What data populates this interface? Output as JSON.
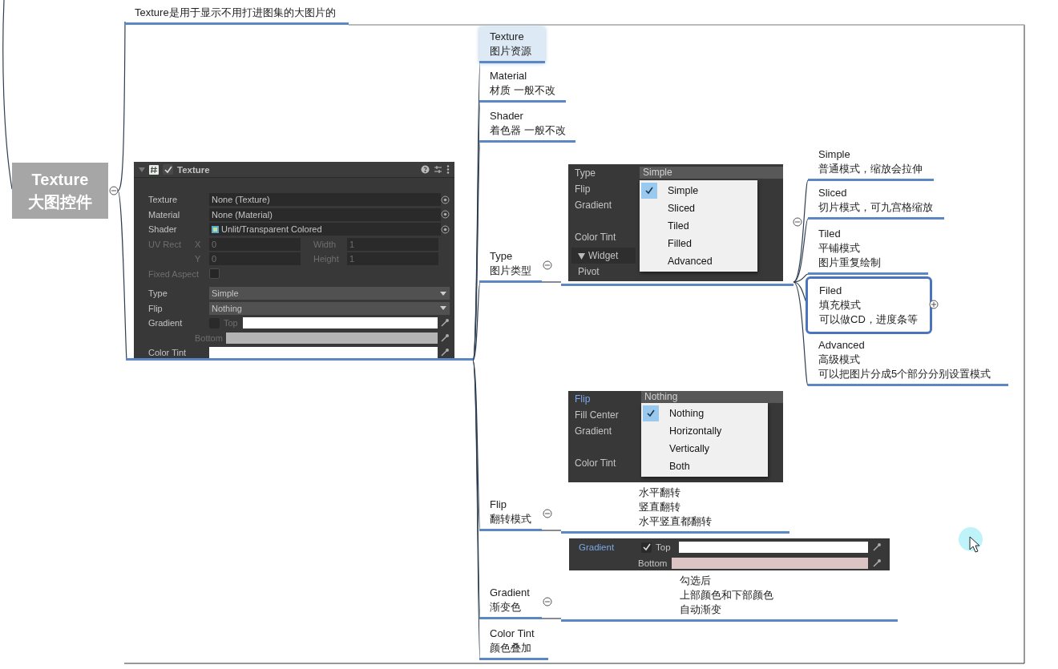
{
  "root": {
    "lines": [
      "Texture",
      "大图控件"
    ],
    "expanded": true
  },
  "root_note": {
    "lines": [
      "Texture是用于显示不用打进图集的大图片的"
    ]
  },
  "inspector": {
    "title": "Texture",
    "enabled": true,
    "fields": [
      {
        "kind": "object",
        "label": "Texture",
        "value": "None (Texture)",
        "disabled": false
      },
      {
        "kind": "shader",
        "label": "Material",
        "value": "None (Material)",
        "disabled": false
      },
      {
        "kind": "shader_icon",
        "label": "Shader",
        "value": "Unlit/Transparent Colored",
        "disabled": false
      },
      {
        "kind": "rect",
        "label": "UV Rect",
        "axis": "X",
        "value": "0",
        "label_b": "Width",
        "value_b": "1",
        "disabled": true
      },
      {
        "kind": "rect",
        "axis": "Y",
        "value": "0",
        "label_b": "Height",
        "value_b": "1",
        "disabled": true
      },
      {
        "kind": "toggle",
        "label": "Fixed Aspect",
        "checked": false,
        "disabled": true
      },
      {
        "kind": "dropdown",
        "label": "Type",
        "value": "Simple",
        "disabled": false
      },
      {
        "kind": "dropdown",
        "label": "Flip",
        "value": "Nothing",
        "disabled": false
      },
      {
        "kind": "gradient",
        "label": "Gradient",
        "checked": false,
        "sub": "Top",
        "color": "#ffffff",
        "disabled": true
      },
      {
        "kind": "gradient_bottom",
        "sub": "Bottom",
        "color": "#b4b4b4",
        "disabled": true
      },
      {
        "kind": "color",
        "label": "Color Tint",
        "color": "#ffffff",
        "disabled": false
      }
    ]
  },
  "properties": [
    {
      "kind": "leaf",
      "lines": [
        "Texture",
        "图片资源"
      ],
      "selected": true
    },
    {
      "kind": "leaf",
      "lines": [
        "Material",
        "材质 一般不改"
      ],
      "selected": false
    },
    {
      "kind": "leaf",
      "lines": [
        "Shader",
        "着色器 一般不改"
      ],
      "selected": false
    },
    {
      "kind": "branch",
      "lines": [
        "Type",
        "图片类型"
      ],
      "selected": false,
      "expanded": true,
      "detail": {
        "kind": "type_menu",
        "expanded": true,
        "labels": [
          {
            "text": "Type",
            "focused": false
          },
          {
            "text": "Flip",
            "focused": false
          },
          {
            "text": "Gradient",
            "focused": false
          },
          {
            "text": "Color Tint",
            "focused": false
          }
        ],
        "section": "Widget",
        "last_label": "Pivot",
        "value": "Simple",
        "options": [
          {
            "label": "Simple",
            "selected": true
          },
          {
            "label": "Sliced",
            "selected": false
          },
          {
            "label": "Tiled",
            "selected": false
          },
          {
            "label": "Filled",
            "selected": false
          },
          {
            "label": "Advanced",
            "selected": false
          }
        ],
        "children": [
          {
            "kind": "leaf",
            "lines": [
              "Simple",
              "普通模式，缩放会拉伸"
            ],
            "selected": false
          },
          {
            "kind": "leaf",
            "lines": [
              "Sliced",
              "切片模式，可九宫格缩放"
            ],
            "selected": false
          },
          {
            "kind": "leaf",
            "lines": [
              "Tiled",
              "平铺模式",
              "图片重复绘制"
            ],
            "selected": false
          },
          {
            "kind": "branch",
            "lines": [
              "Filed",
              "填充模式",
              "可以做CD，进度条等"
            ],
            "selected": true,
            "expanded": false
          },
          {
            "kind": "leaf",
            "lines": [
              "Advanced",
              "高级模式",
              "可以把图片分成5个部分分别设置模式"
            ],
            "selected": false
          }
        ]
      }
    },
    {
      "kind": "branch",
      "lines": [
        "Flip",
        "翻转模式"
      ],
      "selected": false,
      "expanded": true,
      "detail": {
        "kind": "flip_menu",
        "labels": [
          {
            "text": "Flip",
            "focused": true
          },
          {
            "text": "Fill Center",
            "focused": false
          },
          {
            "text": "Gradient",
            "focused": false
          },
          {
            "text": "Color Tint",
            "focused": false
          }
        ],
        "value": "Nothing",
        "options": [
          {
            "label": "Nothing",
            "selected": true
          },
          {
            "label": "Horizontally",
            "selected": false
          },
          {
            "label": "Vertically",
            "selected": false
          },
          {
            "label": "Both",
            "selected": false
          }
        ],
        "lines": [
          "水平翻转",
          "竖直翻转",
          "水平竖直都翻转"
        ]
      }
    },
    {
      "kind": "branch",
      "lines": [
        "Gradient",
        "渐变色"
      ],
      "selected": false,
      "expanded": true,
      "detail": {
        "kind": "gradient_row",
        "label": {
          "text": "Gradient",
          "focused": true
        },
        "checked": true,
        "swatches": [
          {
            "label": "Top",
            "color": "#ffffff"
          },
          {
            "label": "Bottom",
            "color": "#dcc4c4"
          }
        ],
        "lines": [
          "勾选后",
          "上部颜色和下部颜色",
          "自动渐变"
        ]
      }
    },
    {
      "kind": "leaf",
      "lines": [
        "Color Tint",
        "颜色叠加"
      ],
      "selected": false
    }
  ]
}
